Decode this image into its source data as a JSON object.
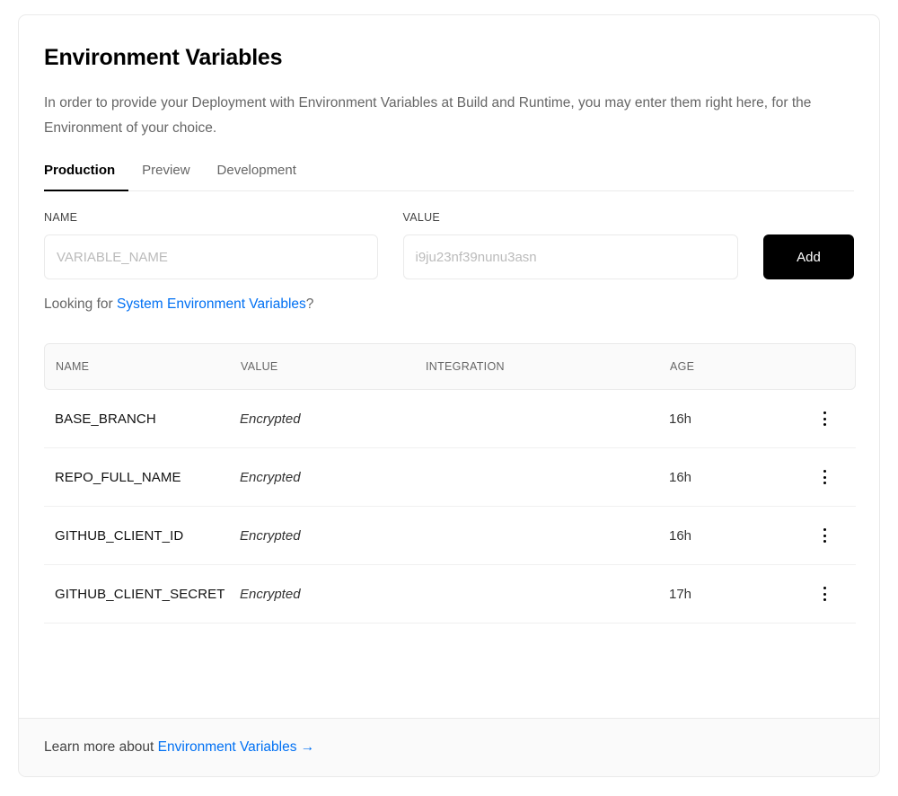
{
  "header": {
    "title": "Environment Variables",
    "description": "In order to provide your Deployment with Environment Variables at Build and Runtime, you may enter them right here, for the Environment of your choice."
  },
  "tabs": [
    {
      "label": "Production",
      "active": true
    },
    {
      "label": "Preview",
      "active": false
    },
    {
      "label": "Development",
      "active": false
    }
  ],
  "form": {
    "name_label": "NAME",
    "name_placeholder": "VARIABLE_NAME",
    "name_value": "",
    "value_label": "VALUE",
    "value_placeholder": "i9ju23nf39nunu3asn",
    "value_value": "",
    "add_label": "Add"
  },
  "looking_for": {
    "prefix": "Looking for ",
    "link": "System Environment Variables",
    "suffix": "?"
  },
  "table": {
    "columns": [
      "NAME",
      "VALUE",
      "INTEGRATION",
      "AGE"
    ],
    "rows": [
      {
        "name": "BASE_BRANCH",
        "value": "Encrypted",
        "integration": "",
        "age": "16h",
        "menu_icon": "kebab-vertical-icon"
      },
      {
        "name": "REPO_FULL_NAME",
        "value": "Encrypted",
        "integration": "",
        "age": "16h",
        "menu_icon": "kebab-vertical-icon"
      },
      {
        "name": "GITHUB_CLIENT_ID",
        "value": "Encrypted",
        "integration": "",
        "age": "16h",
        "menu_icon": "kebab-vertical-icon"
      },
      {
        "name": "GITHUB_CLIENT_SECRET",
        "value": "Encrypted",
        "integration": "",
        "age": "17h",
        "menu_icon": "kebab-vertical-icon"
      }
    ]
  },
  "footer": {
    "prefix": "Learn more about ",
    "link": "Environment Variables",
    "arrow": "→"
  },
  "colors": {
    "accent_link": "#0070f3",
    "button_bg": "#000000",
    "card_border": "#eaeaea",
    "muted_text": "#666666",
    "header_bg": "#fafafa"
  }
}
